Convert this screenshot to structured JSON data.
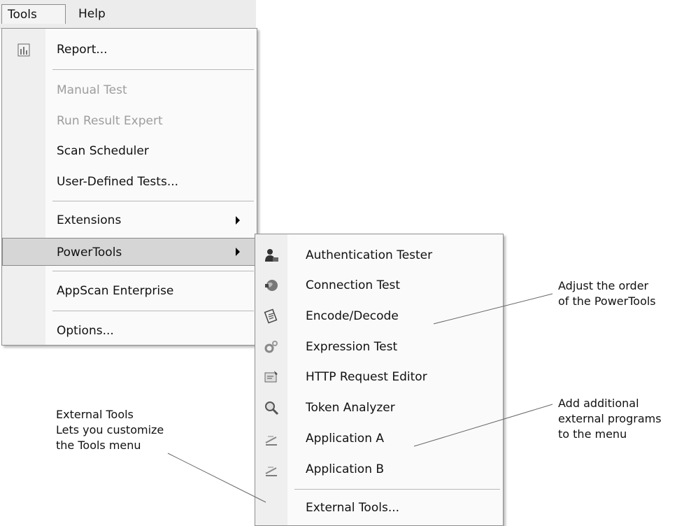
{
  "menubar": {
    "tools": "Tools",
    "help": "Help"
  },
  "tools_menu": {
    "report": "Report...",
    "manual_test": "Manual Test",
    "run_result_expert": "Run Result Expert",
    "scan_scheduler": "Scan Scheduler",
    "user_defined_tests": "User-Defined Tests...",
    "extensions": "Extensions",
    "powertools": "PowerTools",
    "appscan_enterprise": "AppScan Enterprise",
    "options": "Options..."
  },
  "powertools_menu": {
    "authentication_tester": "Authentication Tester",
    "connection_test": "Connection Test",
    "encode_decode": "Encode/Decode",
    "expression_test": "Expression Test",
    "http_request_editor": "HTTP Request Editor",
    "token_analyzer": "Token Analyzer",
    "application_a": "Application A",
    "application_b": "Application B",
    "external_tools": "External Tools..."
  },
  "annotations": {
    "external_tools": [
      "External Tools",
      "Lets you customize",
      "the Tools menu"
    ],
    "adjust_order": [
      "Adjust the order",
      "of the PowerTools"
    ],
    "add_programs": [
      "Add additional",
      "external programs",
      "to the menu"
    ]
  },
  "icons": {
    "report": "report-icon",
    "authentication_tester": "user-icon",
    "connection_test": "globe-icon",
    "encode_decode": "encode-icon",
    "expression_test": "gears-icon",
    "http_request_editor": "request-editor-icon",
    "token_analyzer": "magnifier-icon",
    "application_a": "app-icon",
    "application_b": "app-icon"
  },
  "colors": {
    "highlight": "#d6d6d6",
    "disabled_text": "#9d9d9d",
    "menu_bg": "#fafafa",
    "gutter": "#efefef"
  }
}
